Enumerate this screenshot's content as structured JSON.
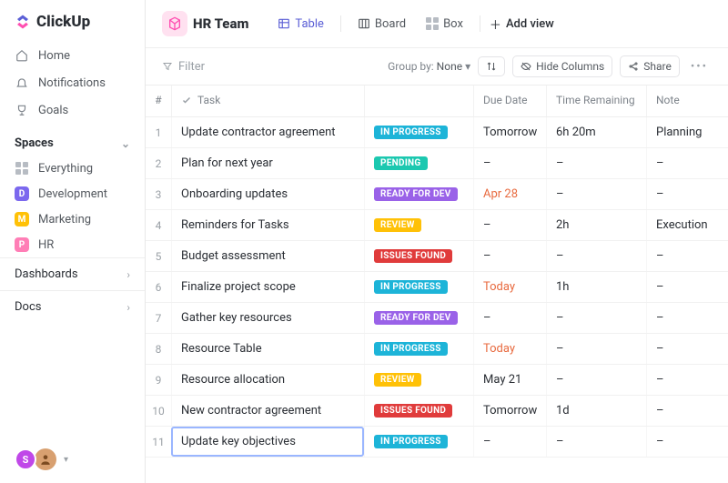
{
  "brand": {
    "name": "ClickUp"
  },
  "nav": {
    "home": "Home",
    "notifications": "Notifications",
    "goals": "Goals"
  },
  "spaces": {
    "header": "Spaces",
    "everything": "Everything",
    "items": [
      {
        "letter": "D",
        "label": "Development",
        "color": "#7b68ee"
      },
      {
        "letter": "M",
        "label": "Marketing",
        "color": "#ffc107"
      },
      {
        "letter": "P",
        "label": "HR",
        "color": "#ff7eb6"
      }
    ]
  },
  "collapsibles": {
    "dashboards": "Dashboards",
    "docs": "Docs"
  },
  "header": {
    "title": "HR Team",
    "views": {
      "table": "Table",
      "board": "Board",
      "box": "Box",
      "add": "Add view"
    }
  },
  "toolbar": {
    "filter": "Filter",
    "group_label": "Group by:",
    "group_value": "None",
    "hide_columns": "Hide Columns",
    "share": "Share"
  },
  "table": {
    "columns": {
      "num": "#",
      "task": "Task",
      "due": "Due Date",
      "time": "Time Remaining",
      "note": "Note"
    },
    "rows": [
      {
        "n": "1",
        "task": "Update contractor agreement",
        "status": "IN PROGRESS",
        "status_color": "#1db4d8",
        "due": "Tomorrow",
        "due_warn": false,
        "time": "6h 20m",
        "note": "Planning"
      },
      {
        "n": "2",
        "task": "Plan for next year",
        "status": "PENDING",
        "status_color": "#1cc8b0",
        "due": "–",
        "due_warn": false,
        "time": "–",
        "note": "–"
      },
      {
        "n": "3",
        "task": "Onboarding updates",
        "status": "READY FOR DEV",
        "status_color": "#9a62e8",
        "due": "Apr 28",
        "due_warn": true,
        "time": "–",
        "note": "–"
      },
      {
        "n": "4",
        "task": "Reminders for Tasks",
        "status": "REVIEW",
        "status_color": "#ffc107",
        "due": "–",
        "due_warn": false,
        "time": "2h",
        "note": "Execution"
      },
      {
        "n": "5",
        "task": "Budget assessment",
        "status": "ISSUES FOUND",
        "status_color": "#e03b3b",
        "due": "–",
        "due_warn": false,
        "time": "–",
        "note": "–"
      },
      {
        "n": "6",
        "task": "Finalize project scope",
        "status": "IN PROGRESS",
        "status_color": "#1db4d8",
        "due": "Today",
        "due_warn": true,
        "time": "1h",
        "note": "–"
      },
      {
        "n": "7",
        "task": "Gather key resources",
        "status": "READY FOR DEV",
        "status_color": "#9a62e8",
        "due": "–",
        "due_warn": false,
        "time": "–",
        "note": "–"
      },
      {
        "n": "8",
        "task": "Resource Table",
        "status": "IN PROGRESS",
        "status_color": "#1db4d8",
        "due": "Today",
        "due_warn": true,
        "time": "–",
        "note": "–"
      },
      {
        "n": "9",
        "task": "Resource allocation",
        "status": "REVIEW",
        "status_color": "#ffc107",
        "due": "May 21",
        "due_warn": false,
        "time": "–",
        "note": "–"
      },
      {
        "n": "10",
        "task": "New contractor agreement",
        "status": "ISSUES FOUND",
        "status_color": "#e03b3b",
        "due": "Tomorrow",
        "due_warn": false,
        "time": "1d",
        "note": "–"
      },
      {
        "n": "11",
        "task": "Update key objectives",
        "status": "IN PROGRESS",
        "status_color": "#1db4d8",
        "due": "–",
        "due_warn": false,
        "time": "–",
        "note": "–",
        "editing": true
      }
    ]
  },
  "avatars": {
    "s": "S"
  }
}
